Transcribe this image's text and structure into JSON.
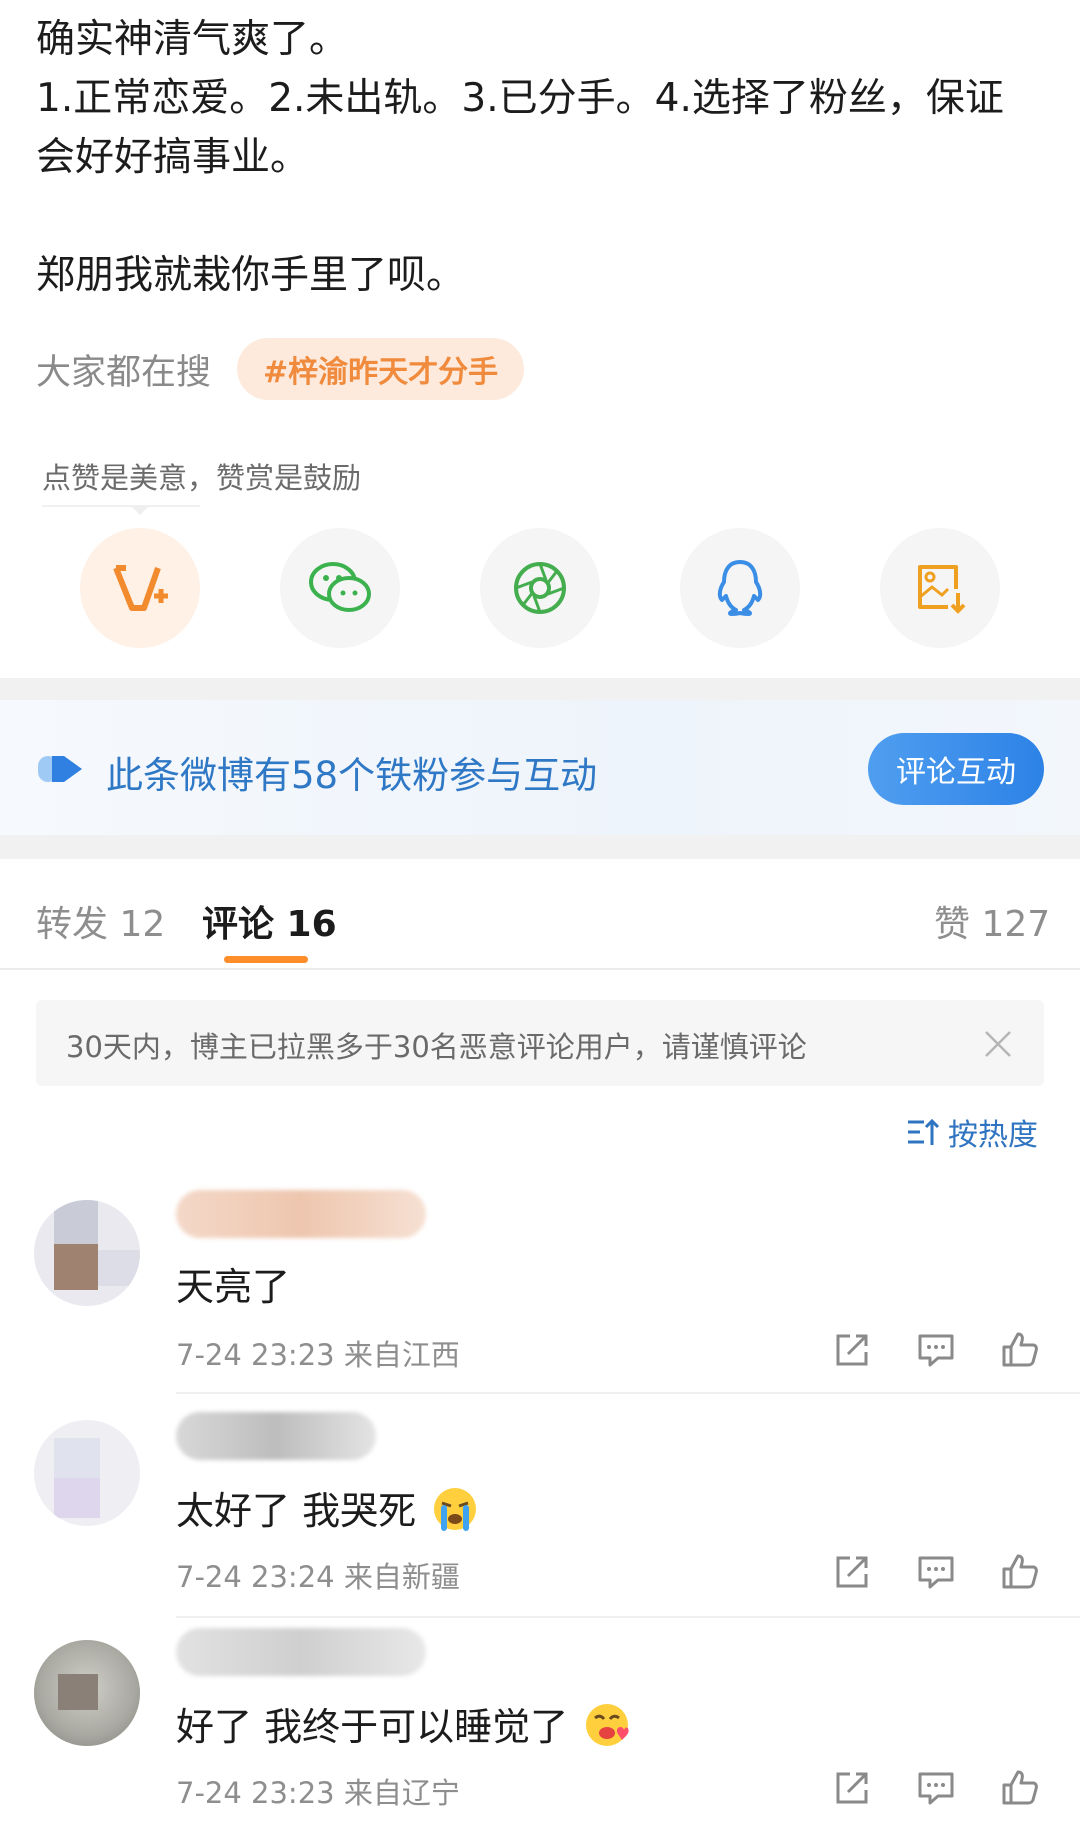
{
  "post": {
    "lines": [
      "确实神清气爽了。",
      "1.正常恋爱。2.未出轨。3.已分手。4.选择了粉丝，保证",
      "会好好搞事业。",
      "郑朋我就栽你手里了呗。"
    ],
    "search_label": "大家都在搜",
    "search_tag": "#梓渝昨天才分手"
  },
  "reward": {
    "tip": "点赞是美意，赞赏是鼓励",
    "share_icons": [
      "reward-v-icon",
      "wechat-icon",
      "moments-icon",
      "qq-icon",
      "save-image-icon"
    ]
  },
  "fans": {
    "text": "此条微博有58个铁粉参与互动",
    "button": "评论互动"
  },
  "tabs": {
    "repost": "转发 12",
    "comments": "评论 16",
    "likes": "赞 127"
  },
  "notice": {
    "text": "30天内，博主已拉黑多于30名恶意评论用户，请谨慎评论"
  },
  "sort": {
    "label": "按热度"
  },
  "comments": [
    {
      "text": "天亮了",
      "meta": "7-24 23:23 来自江西"
    },
    {
      "text": "太好了 我哭死",
      "meta": "7-24 23:24 来自新疆",
      "emoji": "crying-face"
    },
    {
      "text": "好了 我终于可以睡觉了",
      "meta": "7-24 23:23 来自辽宁",
      "emoji": "love-face"
    }
  ],
  "colors": {
    "accent": "#ff8d2a",
    "link": "#2f78c5",
    "tag_bg": "#fdeadd"
  }
}
